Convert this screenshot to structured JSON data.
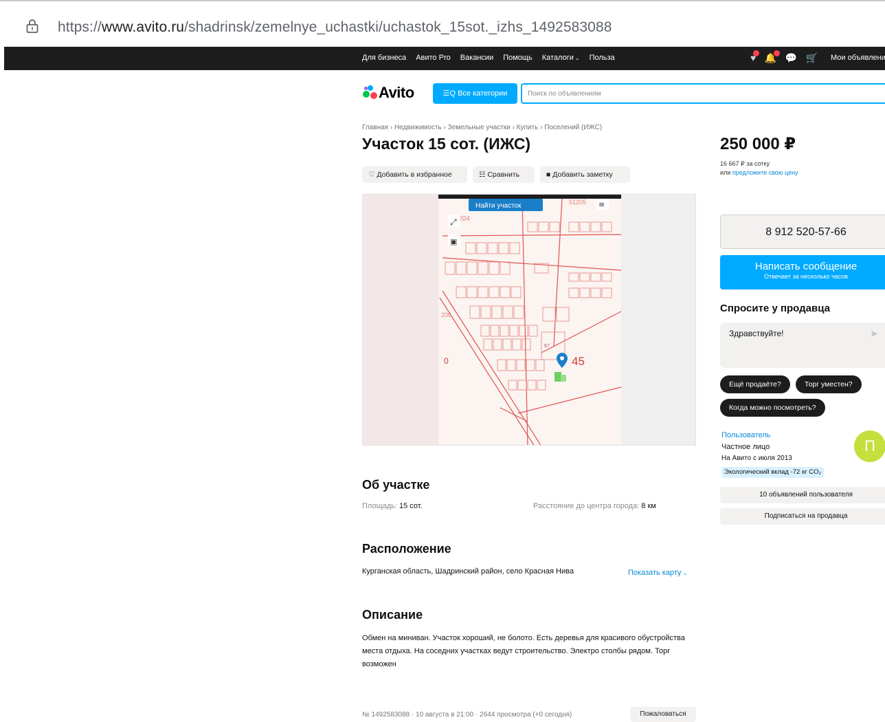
{
  "browser": {
    "url_prefix": "https://",
    "url_host": "www.avito.ru",
    "url_path": "/shadrinsk/zemelnye_uchastki/uchastok_15sot._izhs_1492583088"
  },
  "topnav": {
    "links": [
      "Для бизнеса",
      "Авито Pro",
      "Вакансии",
      "Помощь",
      "Каталоги",
      "Польза"
    ],
    "my_ads": "Мои объявления"
  },
  "header": {
    "logo_text": "Avito",
    "categories_button": "Все категории",
    "search_placeholder": "Поиск по объявлениям"
  },
  "breadcrumbs": [
    "Главная",
    "Недвижимость",
    "Земельные участки",
    "Купить",
    "Поселений (ИЖС)"
  ],
  "listing": {
    "title": "Участок 15 сот. (ИЖС)",
    "actions": {
      "favorite": "Добавить в избранное",
      "compare": "Сравнить",
      "note": "Добавить заметку"
    },
    "map": {
      "find_button": "Найти участок",
      "label_a": "51204",
      "label_b": "51205",
      "label_c": "45",
      "label_d": "0",
      "label_e": "206",
      "label_f": "67"
    }
  },
  "about": {
    "heading": "Об участке",
    "area_label": "Площадь:",
    "area_value": "15 сот.",
    "distance_label": "Расстояние до центра города:",
    "distance_value": "8 км"
  },
  "location": {
    "heading": "Расположение",
    "address": "Курганская область, Шадринский район, село Красная Нива",
    "show_map": "Показать карту"
  },
  "description": {
    "heading": "Описание",
    "text": "Обмен на миниван. Участок хороший, не болото. Есть деревья для красивого обустройства места отдыха. На соседних участках ведут строительство. Электро столбы рядом. Торг возможен"
  },
  "footer": {
    "meta": "№ 1492583088 · 10 августа в 21:00 · 2644 просмотра (+0 сегодня)",
    "complain": "Пожаловаться"
  },
  "sidebar": {
    "price": "250 000 ₽",
    "price_per": "16 667 ₽ за сотку",
    "offer_prefix": "или",
    "offer_link": "предложите свою цену",
    "phone": "8 912 520-57-66",
    "write_button": "Написать сообщение",
    "write_sub": "Отвечает за несколько часов",
    "ask_heading": "Спросите у продавца",
    "message_draft": "Здравствуйте!",
    "chips": [
      "Ещё продаёте?",
      "Торг уместен?",
      "Когда можно посмотреть?"
    ],
    "seller_name": "Пользователь",
    "seller_type": "Частное лицо",
    "seller_since": "На Авито с июля 2013",
    "eco": "Экологический вклад -72 кг CO₂",
    "avatar_letter": "П",
    "user_ads": "10 объявлений пользователя",
    "subscribe": "Подписаться на продавца"
  },
  "colors": {
    "accent": "#00aaff",
    "nav_bg": "#1d1d1d",
    "link": "#0a88d6",
    "map_line": "#e0524f"
  }
}
